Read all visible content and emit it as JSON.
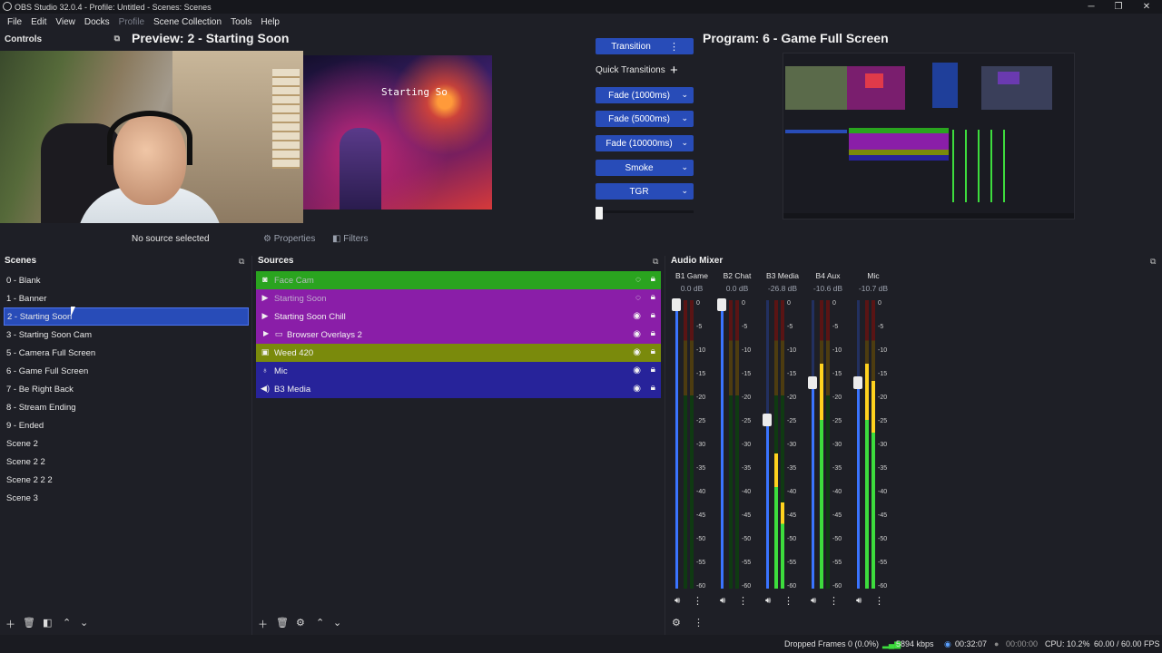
{
  "window": {
    "title": "OBS Studio 32.0.4 - Profile: Untitled - Scenes: Scenes",
    "minimize": "─",
    "maximize": "❐",
    "close": "✕"
  },
  "menu": [
    "File",
    "Edit",
    "View",
    "Docks",
    "Profile",
    "Scene Collection",
    "Tools",
    "Help"
  ],
  "controls": {
    "title": "Controls"
  },
  "preview": {
    "title": "Preview: 2 - Starting Soon",
    "overlay_text": "Starting So"
  },
  "program": {
    "title": "Program: 6 - Game Full Screen"
  },
  "transitions": {
    "transition_label": "Transition",
    "quick_label": "Quick Transitions",
    "items": [
      "Fade (1000ms)",
      "Fade (5000ms)",
      "Fade (10000ms)",
      "Smoke",
      "TGR"
    ]
  },
  "info": {
    "no_source": "No source selected",
    "properties": "Properties",
    "filters": "Filters"
  },
  "scenes": {
    "title": "Scenes",
    "items": [
      "0 - Blank",
      "1 - Banner",
      "2 - Starting Soon",
      "3 - Starting Soon Cam",
      "5 - Camera Full Screen",
      "6 - Game Full Screen",
      "7 - Be Right Back",
      "8 - Stream Ending",
      "9 - Ended",
      "Scene 2",
      "Scene 2 2",
      "Scene 2 2 2",
      "Scene 3"
    ],
    "selected_index": 2
  },
  "sources": {
    "title": "Sources",
    "items": [
      {
        "name": "Face Cam",
        "color": "#2aa41f"
      },
      {
        "name": "Starting Soon",
        "color": "#8a1ea8"
      },
      {
        "name": "Starting Soon Chill",
        "color": "#8a1ea8"
      },
      {
        "name": "Browser Overlays 2",
        "color": "#8a1ea8"
      },
      {
        "name": "Weed 420",
        "color": "#7a8a0c"
      },
      {
        "name": "Mic",
        "color": "#27239a"
      },
      {
        "name": "B3 Media",
        "color": "#27239a"
      }
    ]
  },
  "mixer": {
    "title": "Audio Mixer",
    "scale": [
      "0",
      "-5",
      "-10",
      "-15",
      "-20",
      "-25",
      "-30",
      "-35",
      "-40",
      "-45",
      "-50",
      "-55",
      "-60"
    ],
    "channels": [
      {
        "name": "B1 Game",
        "db": "0.0 dB",
        "fader": 1.0,
        "levelL": 0,
        "levelR": 0
      },
      {
        "name": "B2 Chat",
        "db": "0.0 dB",
        "fader": 1.0,
        "levelL": 0,
        "levelR": 0
      },
      {
        "name": "B3 Media",
        "db": "-26.8 dB",
        "fader": 0.6,
        "levelL": 0.47,
        "levelR": 0.3
      },
      {
        "name": "B4 Aux",
        "db": "-10.6 dB",
        "fader": 0.73,
        "levelL": 0.78,
        "levelR": 0.0
      },
      {
        "name": "Mic",
        "db": "-10.7 dB",
        "fader": 0.73,
        "levelL": 0.78,
        "levelR": 0.72
      }
    ]
  },
  "status": {
    "dropped": "Dropped Frames 0 (0.0%)",
    "kbps": "5894 kbps",
    "stream_time": "00:32:07",
    "rec_time": "00:00:00",
    "cpu": "CPU: 10.2%",
    "fps": "60.00 / 60.00 FPS"
  }
}
